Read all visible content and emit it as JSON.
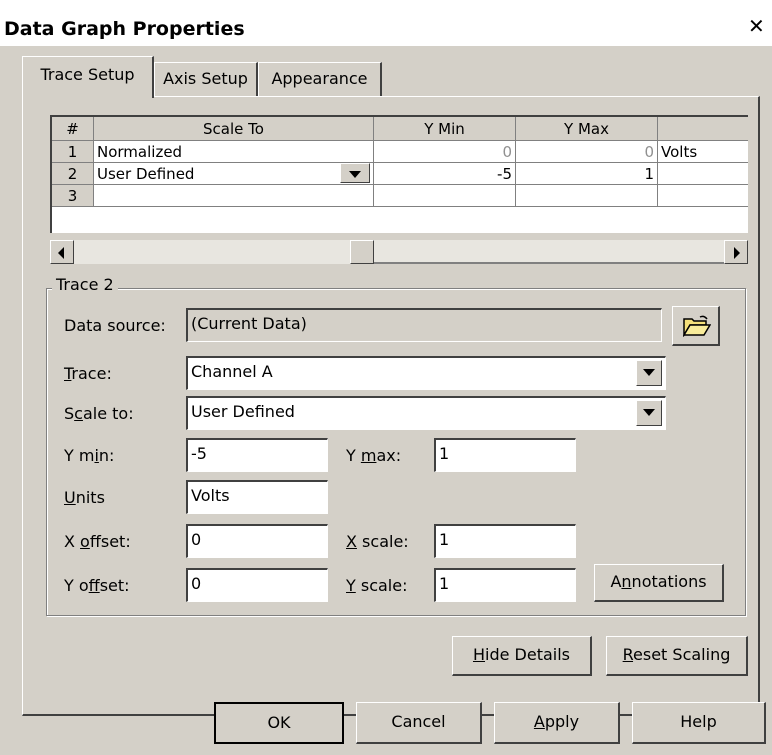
{
  "window": {
    "title": "Data Graph Properties",
    "close_glyph": "✕"
  },
  "tabs": [
    {
      "label": "Trace Setup",
      "active": true
    },
    {
      "label": "Axis Setup",
      "active": false
    },
    {
      "label": "Appearance",
      "active": false
    }
  ],
  "grid": {
    "headers": [
      "#",
      "Scale To",
      "Y Min",
      "Y Max",
      ""
    ],
    "rows": [
      {
        "num": "1",
        "scale_to": "Normalized",
        "y_min": "0",
        "y_max": "0",
        "units": "Volts",
        "disabled": true
      },
      {
        "num": "2",
        "scale_to": "User Defined",
        "y_min": "-5",
        "y_max": "1",
        "units": "",
        "has_dropdown": true
      },
      {
        "num": "3",
        "scale_to": "",
        "y_min": "",
        "y_max": "",
        "units": ""
      }
    ]
  },
  "trace_group": {
    "title": "Trace 2",
    "data_source_label": "Data source:",
    "data_source_value": "(Current Data)",
    "trace_label": "Trace:",
    "trace_value": "Channel A",
    "scale_to_label": "Scale to:",
    "scale_to_value": "User Defined",
    "y_min_label": "Y min:",
    "y_min_value": "-5",
    "y_max_label": "Y max:",
    "y_max_value": "1",
    "units_label": "Units",
    "units_value": "Volts",
    "x_offset_label": "X offset:",
    "x_offset_value": "0",
    "x_scale_label": "X scale:",
    "x_scale_value": "1",
    "y_offset_label": "Y offset:",
    "y_offset_value": "0",
    "y_scale_label": "Y scale:",
    "y_scale_value": "1",
    "annotations_label": "Annotations"
  },
  "panel_buttons": {
    "hide_details": "Hide Details",
    "reset_scaling": "Reset Scaling"
  },
  "dialog_buttons": {
    "ok": "OK",
    "cancel": "Cancel",
    "apply": "Apply",
    "help": "Help"
  },
  "icons": {
    "folder": "folder-open-icon",
    "dropdown": "chevron-down-icon",
    "scroll_left": "arrow-left-icon",
    "scroll_right": "arrow-right-icon"
  }
}
